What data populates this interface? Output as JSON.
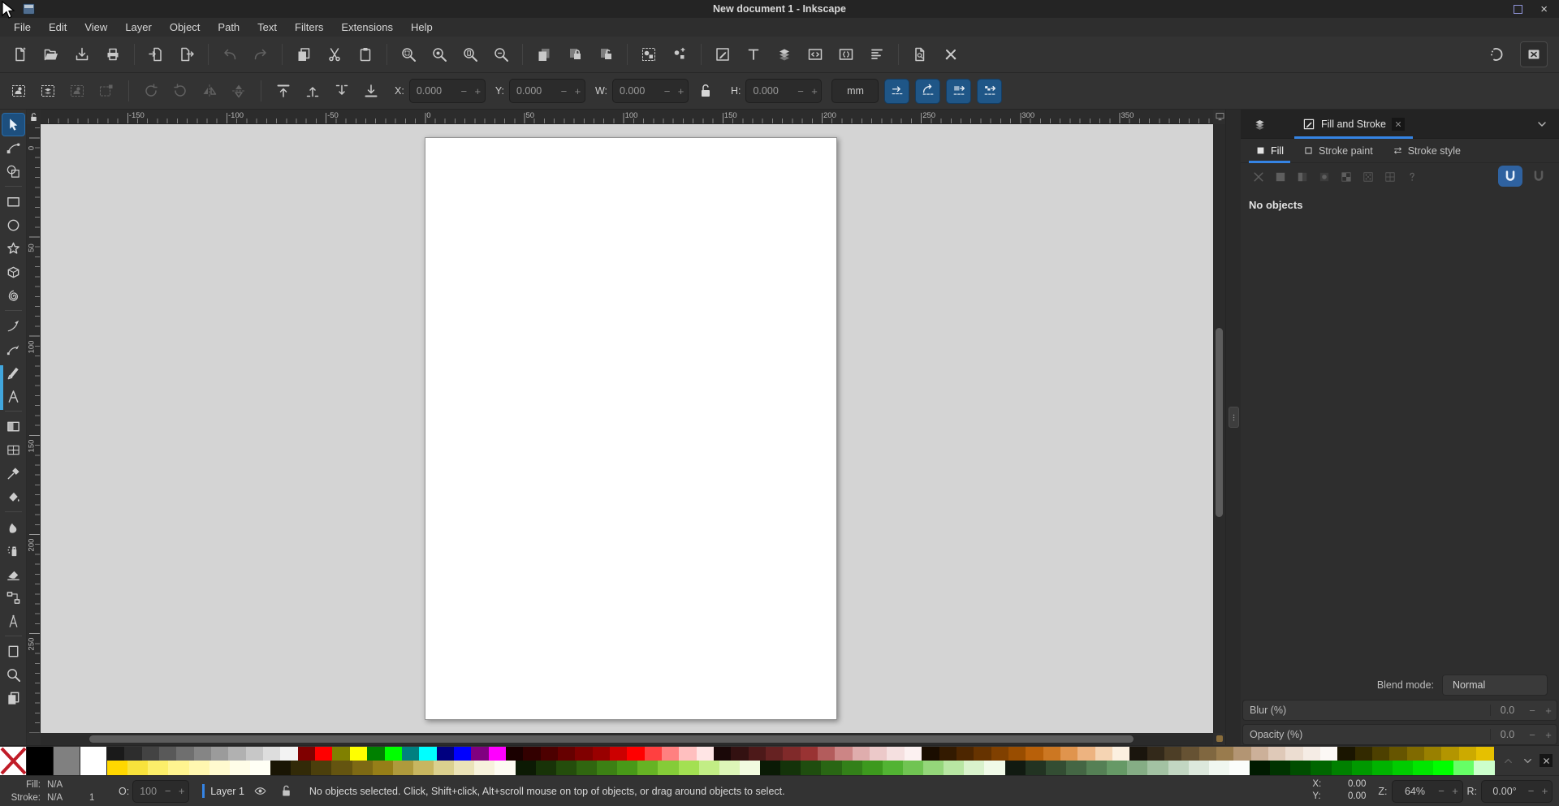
{
  "window": {
    "title": "New document 1 - Inkscape"
  },
  "menubar": {
    "items": [
      "File",
      "Edit",
      "View",
      "Layer",
      "Object",
      "Path",
      "Text",
      "Filters",
      "Extensions",
      "Help"
    ]
  },
  "command_toolbar": {
    "groups": [
      [
        "document-new",
        "document-open",
        "document-save",
        "document-print"
      ],
      [
        "document-import",
        "document-export"
      ],
      [
        "edit-undo",
        "edit-redo"
      ],
      [
        "edit-copy",
        "edit-cut",
        "edit-paste"
      ],
      [
        "zoom-selection",
        "zoom-drawing",
        "zoom-page",
        "zoom-page-width"
      ],
      [
        "duplicate",
        "clone",
        "unlink-clone"
      ],
      [
        "group-objects",
        "ungroup-objects"
      ],
      [
        "fill-stroke-dialog",
        "text-dialog",
        "layers-dialog",
        "xml-editor",
        "object-properties",
        "align-dialog"
      ],
      [
        "document-properties",
        "preferences"
      ]
    ],
    "disabled": [
      "edit-undo",
      "edit-redo"
    ]
  },
  "tool_options": {
    "buttons": [
      {
        "name": "select-all",
        "enabled": true
      },
      {
        "name": "select-all-layers",
        "enabled": true
      },
      {
        "name": "deselect",
        "enabled": false
      },
      {
        "name": "selection-box",
        "enabled": false
      },
      {
        "name": "rotate-ccw",
        "enabled": false
      },
      {
        "name": "rotate-cw",
        "enabled": false
      },
      {
        "name": "flip-horizontal",
        "enabled": false
      },
      {
        "name": "flip-vertical",
        "enabled": false
      },
      {
        "name": "raise-to-top",
        "enabled": true
      },
      {
        "name": "raise",
        "enabled": true
      },
      {
        "name": "lower",
        "enabled": true
      },
      {
        "name": "lower-to-bottom",
        "enabled": true
      }
    ],
    "fields": [
      {
        "label": "X:",
        "value": "0.000"
      },
      {
        "label": "Y:",
        "value": "0.000"
      },
      {
        "label": "W:",
        "value": "0.000"
      },
      {
        "label": "H:",
        "value": "0.000"
      }
    ],
    "unit": "mm",
    "toggles": [
      "scale-stroke",
      "scale-corners",
      "move-gradients",
      "move-patterns"
    ]
  },
  "toolbox": {
    "tools": [
      "selector",
      "node-editor",
      "shape-builder",
      "|",
      "rectangle",
      "ellipse",
      "star",
      "box-3d",
      "spiral",
      "|",
      "pencil",
      "pen",
      "calligraphy",
      "text",
      "|",
      "gradient",
      "mesh-gradient",
      "dropper",
      "paint-bucket",
      "|",
      "tweak",
      "spray",
      "eraser",
      "connector",
      "measure",
      "|",
      "page",
      "zoom-tool",
      "pages"
    ],
    "active": "selector"
  },
  "rulers": {
    "horizontal": [
      "-150",
      "-100",
      "-50",
      "0",
      "50",
      "100",
      "150",
      "200",
      "250",
      "300",
      "350"
    ],
    "vertical": [
      "0",
      "50",
      "100",
      "150",
      "200",
      "250"
    ]
  },
  "dock": {
    "header": {
      "tab": "Fill and Stroke"
    },
    "tabs": [
      {
        "label": "Fill"
      },
      {
        "label": "Stroke paint"
      },
      {
        "label": "Stroke style"
      }
    ],
    "paint_buttons": [
      "no-paint",
      "flat-color",
      "linear-gradient",
      "radial-gradient",
      "pattern",
      "swatch",
      "mesh-paint",
      "unknown-paint"
    ],
    "fill_rule": [
      "fill-rule-nonzero",
      "fill-rule-evenodd"
    ],
    "empty_text": "No objects",
    "blend": {
      "label": "Blend mode:",
      "value": "Normal"
    },
    "blur": {
      "label": "Blur (%)",
      "value": "0.0"
    },
    "opacity": {
      "label": "Opacity (%)",
      "value": "0.0"
    }
  },
  "palette": {
    "special": [
      "none",
      "000000",
      "808080",
      "ffffff"
    ],
    "top_row": [
      "1a1a1a",
      "2d2d2d",
      "434343",
      "595959",
      "6f6f6f",
      "858585",
      "9b9b9b",
      "b1b1b1",
      "c7c7c7",
      "dddddd",
      "f3f3f3",
      "800000",
      "ff0000",
      "808000",
      "ffff00",
      "008000",
      "00ff00",
      "008080",
      "00ffff",
      "000080",
      "0000ff",
      "800080",
      "ff00ff",
      "1a0000",
      "330000",
      "4d0000",
      "660000",
      "800000",
      "990000",
      "cc0000",
      "ff0000",
      "ff4040",
      "ff8080",
      "ffbfbf",
      "ffe5e5",
      "1a0808",
      "331111",
      "4d1919",
      "662222",
      "802a2a",
      "993333",
      "b35c5c",
      "cc8585",
      "dfadad",
      "ecc9c9",
      "f5e0e0",
      "fcf1f1",
      "1a0d00",
      "331a00",
      "4d2600",
      "663300",
      "804000",
      "994d00",
      "b86009",
      "cc7722",
      "e0944d",
      "edb380",
      "f5d4b3",
      "fcf0e0",
      "1a150d",
      "33291a",
      "4d3e26",
      "665233",
      "806740",
      "997b4d",
      "b39573",
      "ccb099",
      "dfc9b8",
      "ecddd1",
      "f5ece5",
      "fcf8f5",
      "1a1500",
      "332a00",
      "4d4000",
      "665500",
      "806a00",
      "998000",
      "b39500",
      "ccaa00",
      "e6c000"
    ],
    "bottom_row": [
      "ffd700",
      "f8e23c",
      "fcee6a",
      "fff490",
      "fff7b0",
      "fffacf",
      "fffde8",
      "fffff5",
      "191504",
      "322a08",
      "4b3f0c",
      "645410",
      "7d6914",
      "967e18",
      "af9a3c",
      "c8b660",
      "dbd08e",
      "ebe3b8",
      "f7f2dc",
      "fdfbf2",
      "0c1a04",
      "183308",
      "244d0c",
      "306610",
      "3c8014",
      "489918",
      "66b324",
      "85cc38",
      "a3e052",
      "c2ed85",
      "ddf6b8",
      "f2fbe0",
      "0a1a05",
      "14330a",
      "1f4d0f",
      "296614",
      "338019",
      "3d991e",
      "52b333",
      "70c452",
      "94d67a",
      "b8e6a3",
      "d9f2cc",
      "f0fae8",
      "111a11",
      "223322",
      "334d33",
      "446644",
      "558055",
      "669966",
      "85ad85",
      "a3c2a3",
      "c2d6c2",
      "dce8dc",
      "f0f7f0",
      "fbfdfb",
      "001a00",
      "003300",
      "004d00",
      "006600",
      "008000",
      "009900",
      "00b300",
      "00cc00",
      "00e600",
      "00ff00",
      "66ff66",
      "ccffcc"
    ]
  },
  "statusbar": {
    "fill_label": "Fill:",
    "fill_value": "N/A",
    "stroke_label": "Stroke:",
    "stroke_value": "N/A",
    "stroke_width": "1",
    "opacity_label": "O:",
    "opacity_value": "100",
    "layer_label": "Layer 1",
    "message": "No objects selected. Click, Shift+click, Alt+scroll mouse on top of objects, or drag around objects to select.",
    "x_label": "X:",
    "x_value": "0.00",
    "y_label": "Y:",
    "y_value": "0.00",
    "zoom_label": "Z:",
    "zoom_value": "64%",
    "rotation_label": "R:",
    "rotation_value": "0.00°"
  },
  "ui": {
    "minus": "−",
    "plus": "+",
    "close": "×"
  }
}
